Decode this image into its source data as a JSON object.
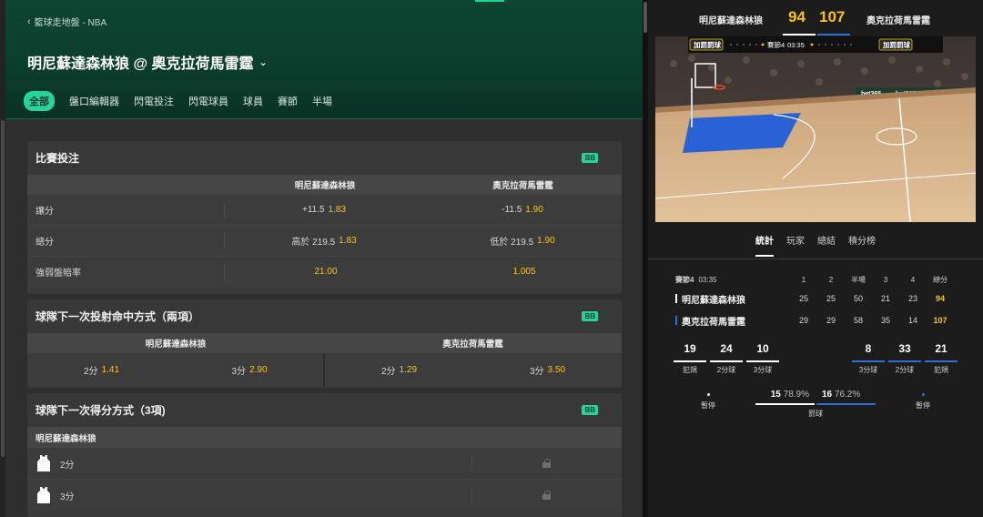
{
  "breadcrumb": "籃球走地盤 - NBA",
  "match_title": "明尼蘇達森林狼 @ 奧克拉荷馬雷霆",
  "tabs": [
    "全部",
    "盤口編輯器",
    "閃電投注",
    "閃電球員",
    "球員",
    "賽節",
    "半場"
  ],
  "bb_badge": "BB",
  "match_bets": {
    "title": "比賽投注",
    "home": "明尼蘇達森林狼",
    "away": "奧克拉荷馬雷霆",
    "rows": [
      {
        "label": "讓分",
        "home_line": "+11.5",
        "home_odds": "1.83",
        "away_line": "-11.5",
        "away_odds": "1.90"
      },
      {
        "label": "總分",
        "home_line": "高於 219.5",
        "home_odds": "1.83",
        "away_line": "低於 219.5",
        "away_odds": "1.90"
      },
      {
        "label": "強弱盤賠率",
        "home_line": "",
        "home_odds": "21.00",
        "away_line": "",
        "away_odds": "1.005"
      }
    ]
  },
  "next_shot": {
    "title": "球隊下一次投射命中方式（兩項）",
    "home": "明尼蘇達森林狼",
    "away": "奧克拉荷馬雷霆",
    "cells": [
      {
        "label": "2分",
        "odds": "1.41"
      },
      {
        "label": "3分",
        "odds": "2.90"
      },
      {
        "label": "2分",
        "odds": "1.29"
      },
      {
        "label": "3分",
        "odds": "3.50"
      }
    ]
  },
  "next_score": {
    "title": "球隊下一次得分方式（3項)",
    "team": "明尼蘇達森林狼",
    "rows": [
      {
        "label": "2分"
      },
      {
        "label": "3分"
      }
    ]
  },
  "scoreboard": {
    "home": "明尼蘇達森林狼",
    "home_score": "94",
    "away_score": "107",
    "away": "奧克拉荷馬雷霆",
    "home_color": "#ffffff",
    "away_color": "#2f6fd6"
  },
  "court": {
    "left_badge": "加罰罰球",
    "right_badge": "加罰罰球",
    "period": "賽節4",
    "clock": "03:35",
    "ad_text": "bet365"
  },
  "stats_tabs": [
    "統計",
    "玩家",
    "總結",
    "積分榜"
  ],
  "box_score": {
    "period_label": "賽節4",
    "clock": "03:35",
    "headers": [
      "1",
      "2",
      "半場",
      "3",
      "4",
      "總分"
    ],
    "teams": [
      {
        "name": "明尼蘇達森林狼",
        "scores": [
          "25",
          "25",
          "50",
          "21",
          "23"
        ],
        "total": "94"
      },
      {
        "name": "奧克拉荷馬雷霆",
        "scores": [
          "29",
          "29",
          "58",
          "35",
          "14"
        ],
        "total": "107"
      }
    ]
  },
  "home_mini": [
    {
      "value": "19",
      "label": "犯規"
    },
    {
      "value": "24",
      "label": "2分球"
    },
    {
      "value": "10",
      "label": "3分球"
    }
  ],
  "away_mini": [
    {
      "value": "8",
      "label": "3分球"
    },
    {
      "value": "33",
      "label": "2分球"
    },
    {
      "value": "21",
      "label": "犯規"
    }
  ],
  "free_throws": {
    "label": "罰球",
    "home_value": "15",
    "home_pct": "78.9%",
    "away_value": "16",
    "away_pct": "76.2%",
    "timeout_label": "暫停"
  }
}
